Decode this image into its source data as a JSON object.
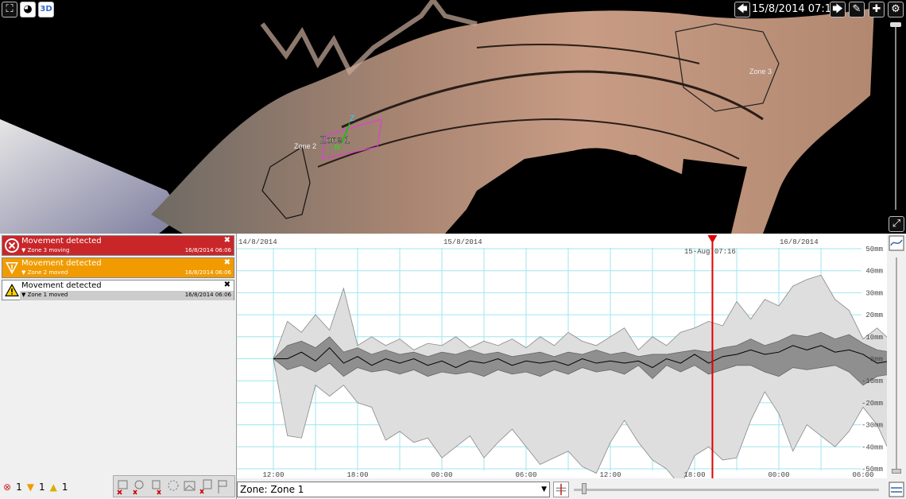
{
  "toolbar": {
    "datetime": "15/8/2014 07:16"
  },
  "viewport": {
    "zone_labels": [
      "Zone 1",
      "Zone 2",
      "Zone 3"
    ],
    "marker_z": "Z",
    "marker_n": "N"
  },
  "alerts": [
    {
      "title": "Movement detected",
      "sub": "Zone 3 moving",
      "time": "16/8/2014 06:06",
      "level": "red"
    },
    {
      "title": "Movement detected",
      "sub": "Zone 2 moved",
      "time": "16/8/2014 06:06",
      "level": "orange"
    },
    {
      "title": "Movement detected",
      "sub": "Zone 1 moved",
      "time": "16/8/2014 06:06",
      "level": "white"
    }
  ],
  "counts": {
    "error": "1",
    "warning": "1",
    "caution": "1"
  },
  "colors": {
    "red": "#c9262a",
    "orange": "#f19b00",
    "cursor": "#e00000"
  },
  "bottom": {
    "zone_select": "Zone: Zone 1"
  },
  "chart_data": {
    "type": "area",
    "date_labels": [
      "14/8/2014",
      "15/8/2014",
      "16/8/2014"
    ],
    "x_ticks": [
      "12:00",
      "18:00",
      "00:00",
      "06:00",
      "12:00",
      "18:00",
      "00:00",
      "06:00"
    ],
    "y_ticks": [
      "50mm",
      "40mm",
      "30mm",
      "20mm",
      "10mm",
      "0mm",
      "-10mm",
      "-20mm",
      "-30mm",
      "-40mm",
      "-50mm"
    ],
    "ylim": [
      -50,
      50
    ],
    "cursor_label": "15-Aug 07:16",
    "cursor_hour": 43.27,
    "x_hours_range": [
      12,
      66
    ],
    "series": [
      {
        "hours": [
          12,
          13,
          14,
          15,
          16,
          17,
          18,
          19,
          20,
          21,
          22,
          23,
          24,
          25,
          26,
          27,
          28,
          29,
          30,
          31,
          32,
          33,
          34,
          35,
          36,
          37,
          38,
          39,
          40,
          41,
          42,
          43,
          44,
          45,
          46,
          47,
          48,
          49,
          50,
          51,
          52,
          53,
          54,
          55,
          56,
          57,
          58,
          59,
          60,
          61,
          62,
          63,
          64,
          65,
          66
        ],
        "upper": [
          0,
          17,
          12,
          20,
          13,
          32,
          6,
          10,
          6,
          9,
          4,
          7,
          6,
          10,
          5,
          8,
          6,
          9,
          5,
          10,
          6,
          12,
          8,
          6,
          10,
          14,
          4,
          10,
          6,
          12,
          14,
          17,
          15,
          26,
          18,
          27,
          24,
          33,
          36,
          38,
          27,
          22,
          9,
          14,
          8,
          12,
          9,
          14,
          10,
          12,
          10,
          12,
          12,
          10,
          10
        ],
        "mid_upper": [
          0,
          6,
          8,
          5,
          10,
          3,
          5,
          2,
          4,
          2,
          3,
          1,
          3,
          2,
          4,
          2,
          3,
          1,
          2,
          3,
          1,
          3,
          2,
          4,
          2,
          3,
          1,
          2,
          2,
          3,
          4,
          3,
          5,
          6,
          9,
          6,
          8,
          11,
          10,
          12,
          9,
          11,
          7,
          4,
          3,
          4,
          5,
          4,
          5,
          4,
          5,
          3,
          4,
          4,
          4
        ],
        "line": [
          0,
          0,
          3,
          -1,
          5,
          -2,
          1,
          -3,
          0,
          -2,
          0,
          -3,
          -1,
          -4,
          -1,
          -2,
          0,
          -3,
          -1,
          -2,
          -1,
          -3,
          0,
          -2,
          -1,
          -2,
          -1,
          -4,
          0,
          -2,
          2,
          -2,
          1,
          2,
          4,
          2,
          3,
          6,
          4,
          6,
          3,
          4,
          2,
          -2,
          -1,
          -3,
          -1,
          -2,
          0,
          -1,
          0,
          -2,
          0,
          -1,
          -2
        ],
        "mid_lower": [
          0,
          -5,
          -3,
          -6,
          -2,
          -8,
          -4,
          -6,
          -5,
          -7,
          -5,
          -8,
          -6,
          -7,
          -6,
          -8,
          -5,
          -7,
          -6,
          -8,
          -5,
          -7,
          -4,
          -6,
          -5,
          -7,
          -3,
          -9,
          -3,
          -6,
          -3,
          -7,
          -5,
          -3,
          -3,
          -6,
          -8,
          -4,
          -5,
          -4,
          -3,
          -6,
          -12,
          -8,
          -7,
          -9,
          -6,
          -8,
          -6,
          -7,
          -5,
          -7,
          -6,
          -6,
          -6
        ],
        "lower": [
          0,
          -35,
          -36,
          -12,
          -17,
          -12,
          -20,
          -22,
          -37,
          -33,
          -38,
          -36,
          -45,
          -40,
          -35,
          -45,
          -38,
          -32,
          -40,
          -48,
          -45,
          -42,
          -49,
          -52,
          -38,
          -28,
          -38,
          -46,
          -50,
          -58,
          -44,
          -40,
          -46,
          -45,
          -28,
          -15,
          -25,
          -42,
          -30,
          -35,
          -40,
          -33,
          -22,
          -30,
          -44,
          -38,
          -40,
          -45,
          -22,
          -38,
          -35,
          -40,
          -30,
          -35,
          -25
        ]
      }
    ]
  }
}
